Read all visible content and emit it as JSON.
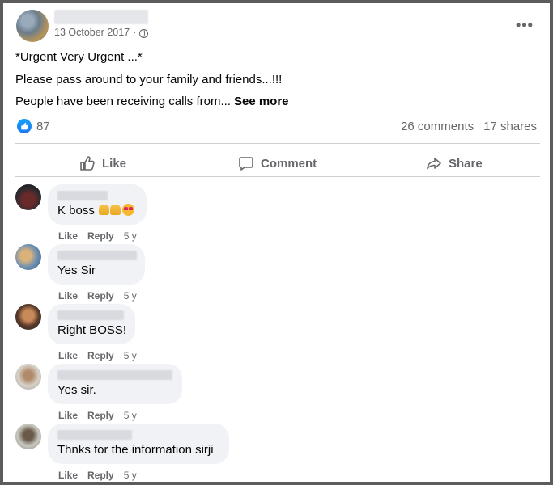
{
  "post": {
    "date": "13 October 2017",
    "separator": "·",
    "lines": [
      "*Urgent Very Urgent ...*",
      "Please pass around to your family and friends...!!!",
      "People have been receiving calls from..."
    ],
    "see_more": "See more",
    "reaction_count": "87",
    "comments_count": "26 comments",
    "shares_count": "17 shares",
    "icons": {
      "privacy": "globe-icon",
      "more": "more-options-icon",
      "reaction": "like-reaction-icon"
    }
  },
  "actions": {
    "like": "Like",
    "comment": "Comment",
    "share": "Share"
  },
  "comments": [
    {
      "text": "K boss",
      "time": "5 y",
      "like": "Like",
      "reply": "Reply",
      "emojis": [
        "folded-hands-icon",
        "folded-hands-icon",
        "heart-eyes-icon"
      ]
    },
    {
      "text": "Yes Sir",
      "time": "5 y",
      "like": "Like",
      "reply": "Reply"
    },
    {
      "text": "Right BOSS!",
      "time": "5 y",
      "like": "Like",
      "reply": "Reply"
    },
    {
      "text": "Yes sir.",
      "time": "5 y",
      "like": "Like",
      "reply": "Reply"
    },
    {
      "text": "Thnks for the information sirji",
      "time": "5 y",
      "like": "Like",
      "reply": "Reply"
    }
  ],
  "colors": {
    "accent": "#1877f2",
    "muted": "#65676b",
    "bubble": "#f0f2f5",
    "divider": "#ced0d4"
  }
}
